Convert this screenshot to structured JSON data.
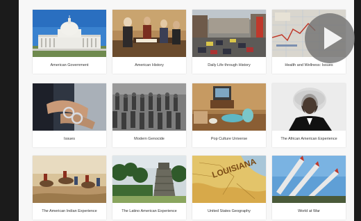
{
  "tiles": [
    {
      "caption": "American Government",
      "image": "us-capitol-building"
    },
    {
      "caption": "American History",
      "image": "historical-painting-figures"
    },
    {
      "caption": "Daily Life through History",
      "image": "busy-city-street"
    },
    {
      "caption": "Health and Wellness: Issues",
      "image": "medical-chart"
    },
    {
      "caption": "Issues",
      "image": "person-in-handcuffs"
    },
    {
      "caption": "Modern Genocide",
      "image": "soldiers-marching"
    },
    {
      "caption": "Pop Culture Universe",
      "image": "retro-living-room-tv"
    },
    {
      "caption": "The African American Experience",
      "image": "frederick-douglass-portrait"
    },
    {
      "caption": "The American Indian Experience",
      "image": "cavalry-battle-painting"
    },
    {
      "caption": "The Latino American Experience",
      "image": "mayan-pyramid-jungle"
    },
    {
      "caption": "United States Geography",
      "image": "louisiana-map"
    },
    {
      "caption": "World at War",
      "image": "missiles-launchers"
    }
  ],
  "play_button": {
    "icon": "play-icon"
  }
}
